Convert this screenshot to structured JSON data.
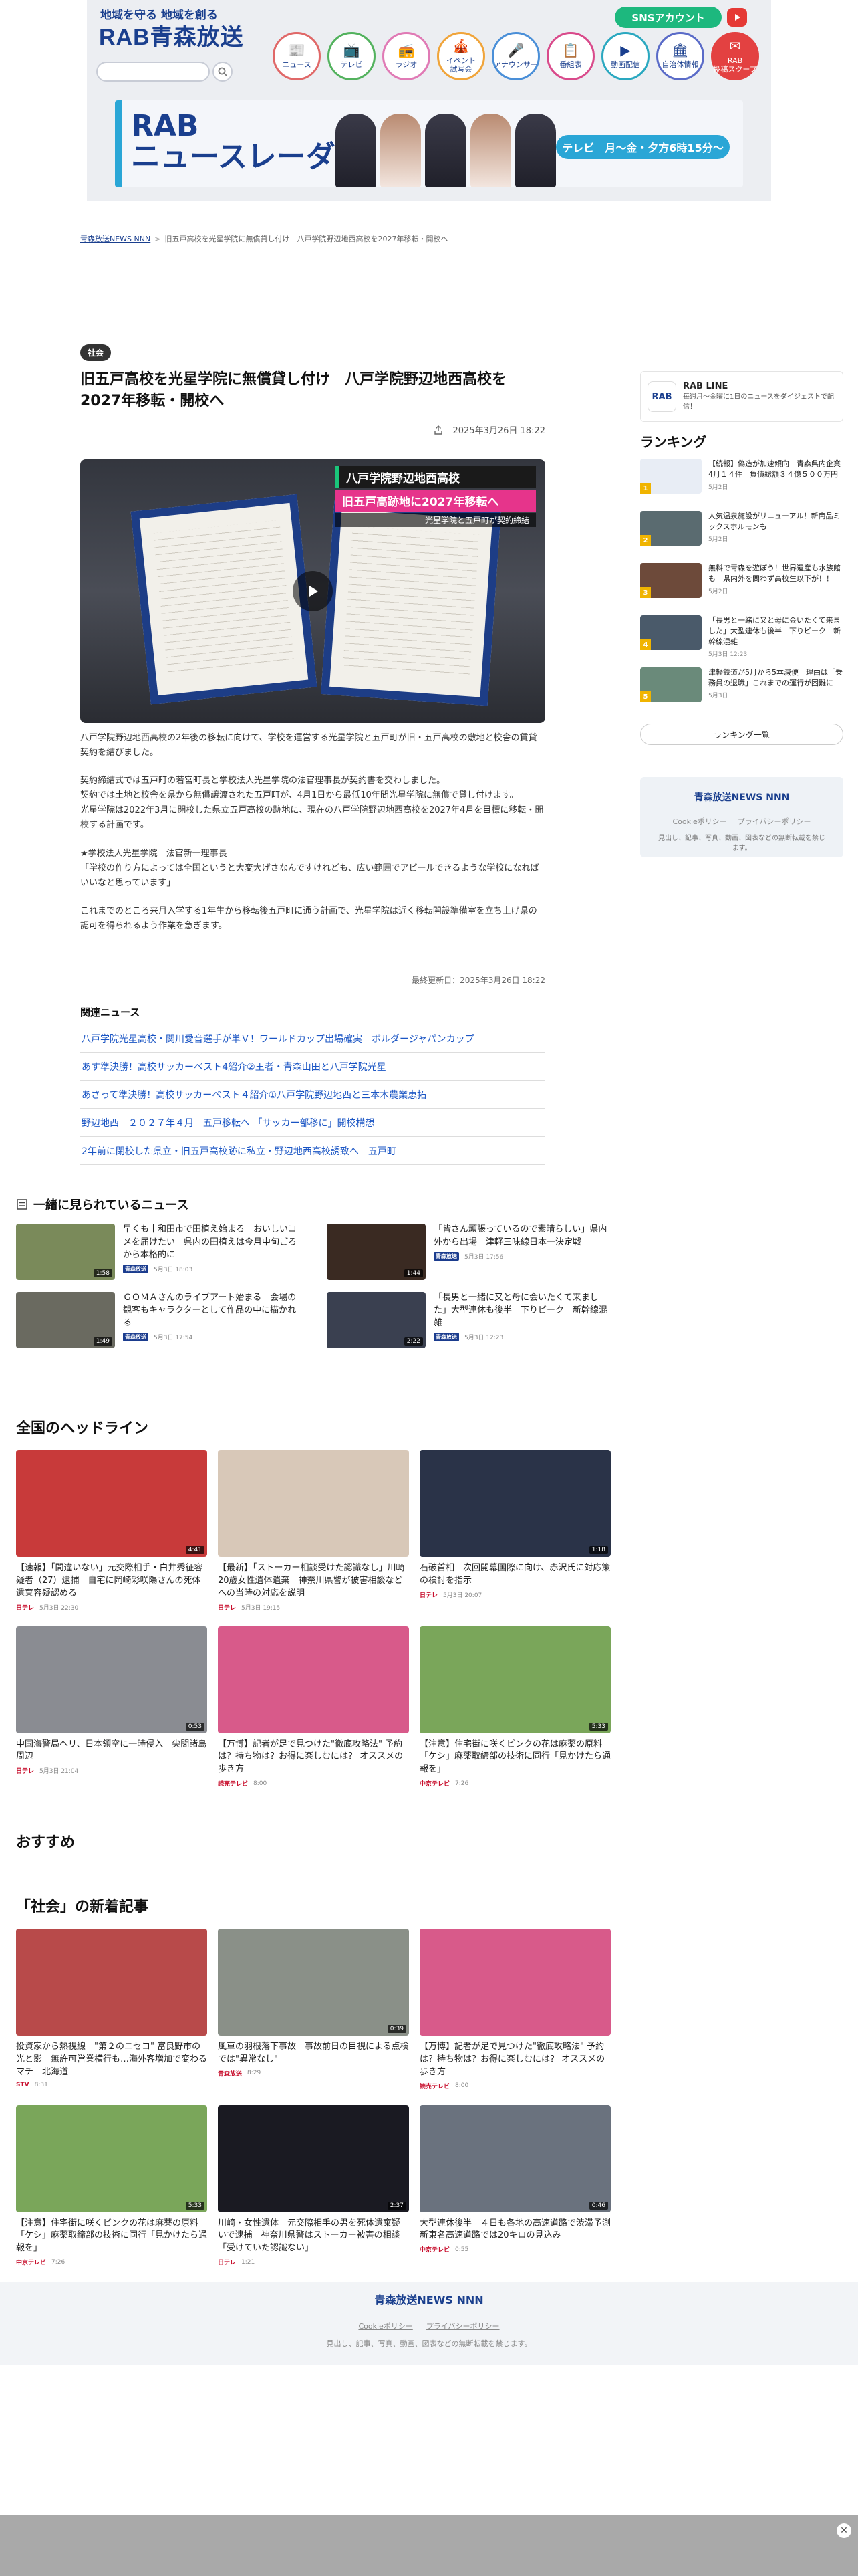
{
  "header": {
    "tagline": "地域を守る 地域を創る",
    "logo": "RAB青森放送",
    "sns_label": "SNSアカウント",
    "nav": [
      {
        "icon": "📰",
        "label": "ニュース"
      },
      {
        "icon": "📺",
        "label": "テレビ"
      },
      {
        "icon": "📻",
        "label": "ラジオ"
      },
      {
        "icon": "🎪",
        "label": "イベント\n試写会"
      },
      {
        "icon": "🎤",
        "label": "アナウンサー"
      },
      {
        "icon": "📋",
        "label": "番組表"
      },
      {
        "icon": "▶",
        "label": "動画配信"
      },
      {
        "icon": "🏛",
        "label": "自治体情報"
      },
      {
        "icon": "✉",
        "label": "RAB\n投稿スクープ"
      }
    ],
    "promo_title": "RAB\nニュースレーダー",
    "promo_time": "テレビ　月〜金・夕方6時15分〜"
  },
  "breadcrumb": {
    "home": "青森放送NEWS NNN",
    "current": "旧五戸高校を光星学院に無償貸し付け　八戸学院野辺地西高校を2027年移転・開校へ"
  },
  "article": {
    "category": "社会",
    "title": "旧五戸高校を光星学院に無償貸し付け　八戸学院野辺地西高校を2027年移転・開校へ",
    "date": "2025年3月26日 18:22",
    "caption1": "八戸学院野辺地西高校",
    "caption2": "旧五戸高跡地に2027年移転へ",
    "caption3": "光星学院と五戸町が契約締結",
    "paragraphs": [
      "八戸学院野辺地西高校の2年後の移転に向けて、学校を運営する光星学院と五戸町が旧・五戸高校の敷地と校舎の賃貸契約を結びました。",
      "契約締結式では五戸町の若宮町長と学校法人光星学院の法官理事長が契約書を交わしました。\n契約では土地と校舎を県から無償譲渡された五戸町が、4月1日から最低10年間光星学院に無償で貸し付けます。\n光星学院は2022年3月に閉校した県立五戸高校の跡地に、現在の八戸学院野辺地西高校を2027年4月を目標に移転・開校する計画です。",
      "★学校法人光星学院　法官新一理事長\n「学校の作り方によっては全国というと大変大げさなんですけれども、広い範囲でアピールできるような学校になればいいなと思っています」",
      "これまでのところ来月入学する1年生から移転後五戸町に通う計画で、光星学院は近く移転開設準備室を立ち上げ県の認可を得られるよう作業を急ぎます。"
    ],
    "updated": "最終更新日：2025年3月26日 18:22",
    "related_title": "関連ニュース",
    "related": [
      "八戸学院光星高校・関川愛音選手が単Ｖ！ワールドカップ出場確実　ボルダージャパンカップ",
      "あす準決勝！高校サッカーベスト4紹介②王者・青森山田と八戸学院光星",
      "あさって準決勝！高校サッカーベスト４紹介①八戸学院野辺地西と三本木農業恵拓",
      "野辺地西　２０２７年４月　五戸移転へ 「サッカー部移に」開校構想",
      "2年前に閉校した県立・旧五戸高校跡に私立・野辺地西高校誘致へ　五戸町"
    ]
  },
  "sidebar": {
    "line_name": "RAB LINE",
    "line_desc": "毎週月〜金曜に1日のニュースをダイジェストで配信！",
    "ranking_title": "ランキング",
    "ranking": [
      {
        "num": "1",
        "title": "【続報】偽造が加速傾向　青森県内企業　4月１４件　負債総額３４億５００万円",
        "date": "5月2日",
        "color": "#e8edf5"
      },
      {
        "num": "2",
        "title": "人気温泉施設がリニューアル！新商品ミックスホルモンも",
        "date": "5月2日",
        "color": "#5a6b70"
      },
      {
        "num": "3",
        "title": "無料で青森を遊ぼう！世界遺産も水族館も　県内外を問わず高校生以下が！！",
        "date": "5月2日",
        "color": "#6d4a3a"
      },
      {
        "num": "4",
        "title": "「長男と一緒に又と母に会いたくて来ました」大型連休も後半　下りピーク　新幹線混雑",
        "date": "5月3日 12:23",
        "color": "#4a5a6a"
      },
      {
        "num": "5",
        "title": "津軽鉄道が5月から5本減便　理由は「乗務員の退職」これまでの運行が困難に",
        "date": "5月3日",
        "color": "#6a8a7a"
      }
    ],
    "ranking_more": "ランキング一覧",
    "foot_logo": "青森放送NEWS NNN",
    "cookie": "Cookieポリシー",
    "privacy": "プライバシーポリシー",
    "copyright": "見出し、記事、写真、動画、図表などの無断転載を禁じます。"
  },
  "coviewed": {
    "title": "一緒に見られているニュース",
    "items": [
      {
        "title": "早くも十和田市で田植え始まる　おいしいコメを届けたい　県内の田植えは今月中旬ごろから本格的に",
        "src": "青森放送",
        "date": "5月3日 18:03",
        "dur": "1:58",
        "color": "#7a8a5a"
      },
      {
        "title": "「皆さん頑張っているので素晴らしい」県内外から出場　津軽三味線日本一決定戦",
        "src": "青森放送",
        "date": "5月3日 17:56",
        "dur": "1:44",
        "color": "#3a2a22"
      },
      {
        "title": "ＧＯＭＡさんのライブアート始まる　会場の観客もキャラクターとして作品の中に描かれる",
        "src": "青森放送",
        "date": "5月3日 17:54",
        "dur": "1:49",
        "color": "#6a6a60"
      },
      {
        "title": "「長男と一緒に又と母に会いたくて来ました」大型連休も後半　下りピーク　新幹線混雑",
        "src": "青森放送",
        "date": "5月3日 12:23",
        "dur": "2:22",
        "color": "#3a4050"
      }
    ]
  },
  "national": {
    "title": "全国のヘッドライン",
    "items": [
      {
        "title": "【速報】「間違いない」元交際相手・白井秀征容疑者（27）逮捕　自宅に岡崎彩咲陽さんの死体遺棄容疑認める",
        "src": "日テレ",
        "date": "5月3日 22:30",
        "dur": "4:41",
        "color": "#c83a3a"
      },
      {
        "title": "【最新】「ストーカー相談受けた認識なし」川崎20歳女性遺体遺棄　神奈川県警が被害相談などへの当時の対応を説明",
        "src": "日テレ",
        "date": "5月3日 19:15",
        "dur": "",
        "color": "#d8c8b8"
      },
      {
        "title": "石破首相　次回開幕国際に向け、赤沢氏に対応策の検討を指示",
        "src": "日テレ",
        "date": "5月3日 20:07",
        "dur": "1:18",
        "color": "#2a3348"
      },
      {
        "title": "中国海警局ヘリ、日本領空に一時侵入　尖閣諸島周辺",
        "src": "日テレ",
        "date": "5月3日 21:04",
        "dur": "0:53",
        "color": "#8a8c92"
      },
      {
        "title": "【万博】記者が足で見つけた\"徹底攻略法\" 予約は？持ち物は？お得に楽しむには？ オススメの歩き方",
        "src": "読売テレビ",
        "date": "8:00",
        "dur": "",
        "color": "#d85a8a"
      },
      {
        "title": "【注意】住宅街に咲くピンクの花は麻薬の原料「ケシ」麻薬取締部の技術に同行「見かけたら通報を」",
        "src": "中京テレビ",
        "date": "7:26",
        "dur": "5:33",
        "color": "#7aa65a"
      }
    ]
  },
  "recommend_title": "おすすめ",
  "shakai": {
    "title": "「社会」の新着記事",
    "items": [
      {
        "title": "投資家から熱視線　\"第２のニセコ\" 富良野市の光と影　無許可営業横行も…海外客増加で変わるマチ　北海道",
        "src": "STV",
        "date": "8:31",
        "dur": "",
        "color": "#b84a4a"
      },
      {
        "title": "風車の羽根落下事故　事故前日の目視による点検では\"異常なし\"",
        "src": "青森放送",
        "date": "8:29",
        "dur": "0:39",
        "color": "#8a9088"
      },
      {
        "title": "【万博】記者が足で見つけた\"徹底攻略法\" 予約は？持ち物は？お得に楽しむには？ オススメの歩き方",
        "src": "読売テレビ",
        "date": "8:00",
        "dur": "",
        "color": "#d85a8a"
      },
      {
        "title": "【注意】住宅街に咲くピンクの花は麻薬の原料「ケシ」麻薬取締部の技術に同行「見かけたら通報を」",
        "src": "中京テレビ",
        "date": "7:26",
        "dur": "5:33",
        "color": "#7aa65a"
      },
      {
        "title": "川崎・女性遺体　元交際相手の男を死体遺棄疑いで逮捕　神奈川県警はストーカー被害の相談「受けていた認識ない」",
        "src": "日テレ",
        "date": "1:21",
        "dur": "2:37",
        "color": "#1a1a22"
      },
      {
        "title": "大型連休後半　４日も各地の高速道路で渋滞予測　新東名高速道路では20キロの見込み",
        "src": "中京テレビ",
        "date": "0:55",
        "dur": "0:46",
        "color": "#6a727e"
      }
    ]
  },
  "footer": {
    "logo": "青森放送NEWS NNN",
    "cookie": "Cookieポリシー",
    "privacy": "プライバシーポリシー",
    "copyright": "見出し、記事、写真、動画、図表などの無断転載を禁じます。"
  }
}
